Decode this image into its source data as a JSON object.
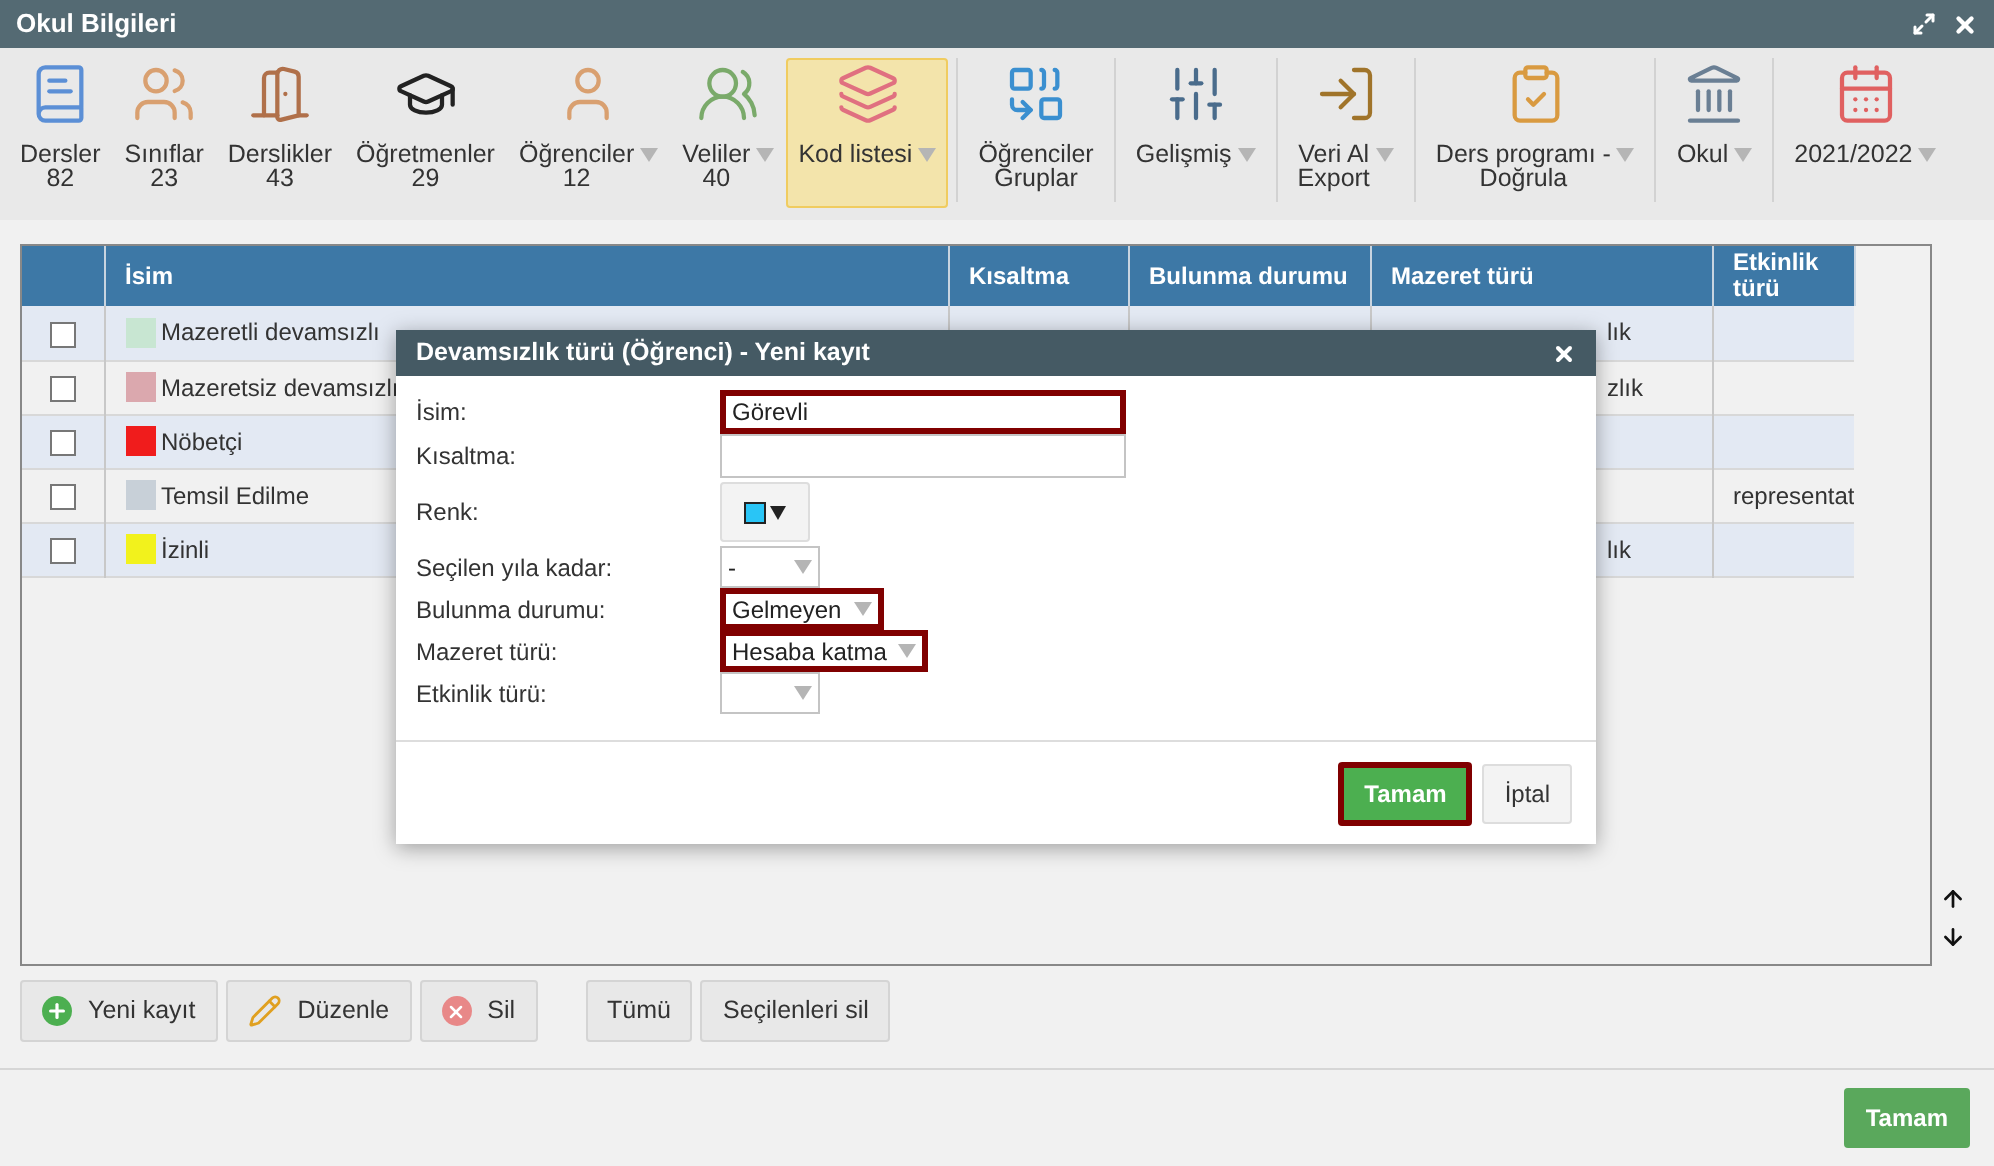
{
  "window": {
    "title": "Okul Bilgileri"
  },
  "toolbar": [
    {
      "label": "Dersler",
      "second_line": "82",
      "dropdown": false,
      "selected": false,
      "separator_before": false
    },
    {
      "label": "Sınıflar",
      "second_line": "23",
      "dropdown": false,
      "selected": false,
      "separator_before": false
    },
    {
      "label": "Derslikler",
      "second_line": "43",
      "dropdown": false,
      "selected": false,
      "separator_before": false
    },
    {
      "label": "Öğretmenler",
      "second_line": "29",
      "dropdown": false,
      "selected": false,
      "separator_before": false
    },
    {
      "label": "Öğrenciler",
      "second_line": "12",
      "dropdown": true,
      "selected": false,
      "separator_before": false
    },
    {
      "label": "Veliler",
      "second_line": "40",
      "dropdown": true,
      "selected": false,
      "separator_before": false
    },
    {
      "label": "Kod listesi",
      "dropdown": true,
      "selected": true,
      "separator_before": false
    },
    {
      "label": "Öğrenciler",
      "second_line": "Gruplar",
      "dropdown": false,
      "selected": false,
      "separator_before": true
    },
    {
      "label": "Gelişmiş",
      "dropdown": true,
      "selected": false,
      "separator_before": true
    },
    {
      "label": "Veri Al",
      "second_line": "Export",
      "dropdown": true,
      "selected": false,
      "separator_before": true
    },
    {
      "label": "Ders programı -",
      "second_line": "Doğrula",
      "dropdown": true,
      "selected": false,
      "separator_before": true
    },
    {
      "label": "Okul",
      "dropdown": true,
      "selected": false,
      "separator_before": true
    },
    {
      "label": "2021/2022",
      "dropdown": true,
      "selected": false,
      "separator_before": true
    }
  ],
  "table": {
    "columns": [
      "İsim",
      "Kısaltma",
      "Bulunma durumu",
      "Mazeret türü",
      "Etkinlik türü"
    ],
    "rows": [
      {
        "checked": false,
        "color": "#c8e6d2",
        "name": "Mazeretli devamsızlı",
        "mazeret": "lık"
      },
      {
        "checked": false,
        "color": "#dba8ae",
        "name": "Mazeretsiz devamsızlı",
        "mazeret": "zlık"
      },
      {
        "checked": false,
        "color": "#f01c1c",
        "name": "Nöbetçi"
      },
      {
        "checked": false,
        "color": "#c8d0d8",
        "name": "Temsil Edilme",
        "etkinlik": "representat"
      },
      {
        "checked": false,
        "color": "#f2f21c",
        "name": "İzinli",
        "mazeret": "lık"
      }
    ]
  },
  "actions": [
    {
      "kind": "add",
      "label": "Yeni kayıt"
    },
    {
      "kind": "edit",
      "label": "Düzenle"
    },
    {
      "kind": "delete",
      "label": "Sil"
    },
    {
      "kind": "plain",
      "label": "Tümü"
    },
    {
      "kind": "plain",
      "label": "Seçilenleri sil"
    }
  ],
  "footer_button": "Tamam",
  "dialog": {
    "title": "Devamsızlık türü (Öğrenci) - Yeni kayıt",
    "fields": [
      {
        "kind": "text",
        "label": "İsim:",
        "value": "Görevli",
        "highlighted": true
      },
      {
        "kind": "text",
        "label": "Kısaltma:",
        "highlighted": false
      },
      {
        "kind": "color",
        "label": "Renk:",
        "color": "#29c5f6"
      },
      {
        "kind": "select",
        "label": "Seçilen yıla kadar:",
        "value": "-",
        "highlighted": false
      },
      {
        "kind": "select",
        "label": "Bulunma durumu:",
        "value": "Gelmeyen",
        "highlighted": true
      },
      {
        "kind": "select",
        "label": "Mazeret türü:",
        "value": "Hesaba katma",
        "highlighted": true
      },
      {
        "kind": "select",
        "label": "Etkinlik türü:",
        "highlighted": false
      }
    ],
    "buttons": [
      {
        "kind": "primary",
        "label": "Tamam",
        "highlighted": true
      },
      {
        "kind": "default",
        "label": "İptal",
        "highlighted": false
      }
    ]
  }
}
